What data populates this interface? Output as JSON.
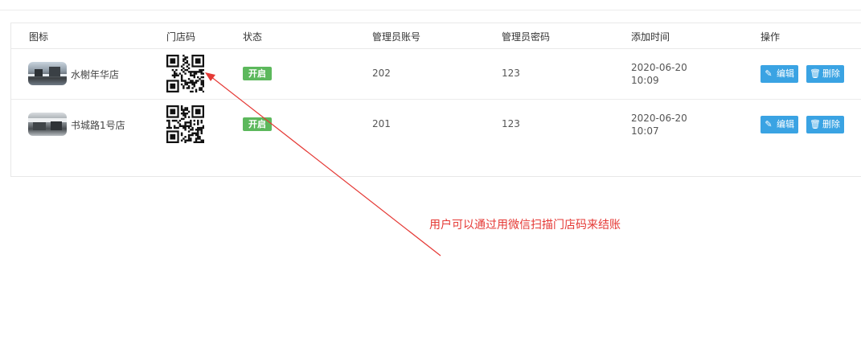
{
  "table": {
    "headers": {
      "icon": "图标",
      "store_code": "门店码",
      "status": "状态",
      "admin_account": "管理员账号",
      "admin_password": "管理员密码",
      "added_time": "添加时间",
      "actions": "操作"
    },
    "rows": [
      {
        "name": "水榭年华店",
        "status": "开启",
        "admin_account": "202",
        "admin_password": "123",
        "date": "2020-06-20",
        "time": "10:09",
        "edit_label": "编辑",
        "delete_label": "删除"
      },
      {
        "name": "书城路1号店",
        "status": "开启",
        "admin_account": "201",
        "admin_password": "123",
        "date": "2020-06-20",
        "time": "10:07",
        "edit_label": "编辑",
        "delete_label": "删除"
      }
    ]
  },
  "annotation": {
    "text": "用户可以通过用微信扫描门店码来结账",
    "color": "#e53935"
  },
  "colors": {
    "status_badge": "#5cb85c",
    "action_button": "#3aa3e3"
  },
  "icons": {
    "edit": "pencil-icon",
    "delete": "trash-icon"
  }
}
